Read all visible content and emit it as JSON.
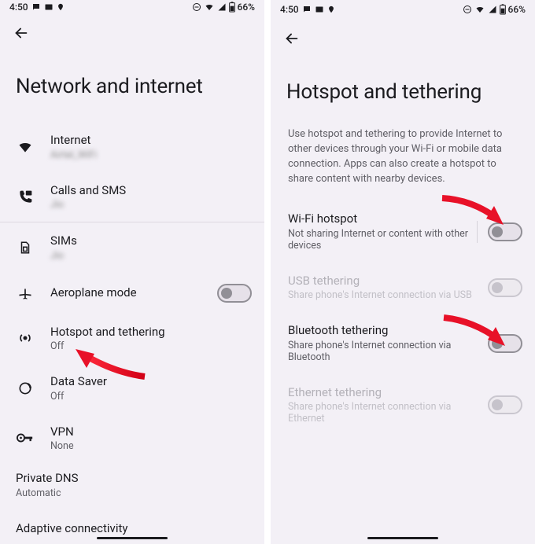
{
  "status": {
    "time": "4:50",
    "battery": "66%"
  },
  "left": {
    "title": "Network and internet",
    "items": {
      "internet": {
        "label": "Internet",
        "sub": "Airtel_WiFi"
      },
      "calls": {
        "label": "Calls and SMS",
        "sub": "Jio"
      },
      "sims": {
        "label": "SIMs",
        "sub": "Jio"
      },
      "aeroplane": {
        "label": "Aeroplane mode"
      },
      "hotspot": {
        "label": "Hotspot and tethering",
        "sub": "Off"
      },
      "datasaver": {
        "label": "Data Saver",
        "sub": "Off"
      },
      "vpn": {
        "label": "VPN",
        "sub": "None"
      },
      "privatedns": {
        "label": "Private DNS",
        "sub": "Automatic"
      },
      "adaptive": {
        "label": "Adaptive connectivity"
      }
    }
  },
  "right": {
    "title": "Hotspot and tethering",
    "description": "Use hotspot and tethering to provide Internet to other devices through your Wi-Fi or mobile data connection. Apps can also create a hotspot to share content with nearby devices.",
    "items": {
      "wifi": {
        "label": "Wi-Fi hotspot",
        "sub": "Not sharing Internet or content with other devices"
      },
      "usb": {
        "label": "USB tethering",
        "sub": "Share phone's Internet connection via USB"
      },
      "bt": {
        "label": "Bluetooth tethering",
        "sub": "Share phone's Internet connection via Bluetooth"
      },
      "eth": {
        "label": "Ethernet tethering",
        "sub": "Share phone's Internet connection via Ethernet"
      }
    }
  }
}
